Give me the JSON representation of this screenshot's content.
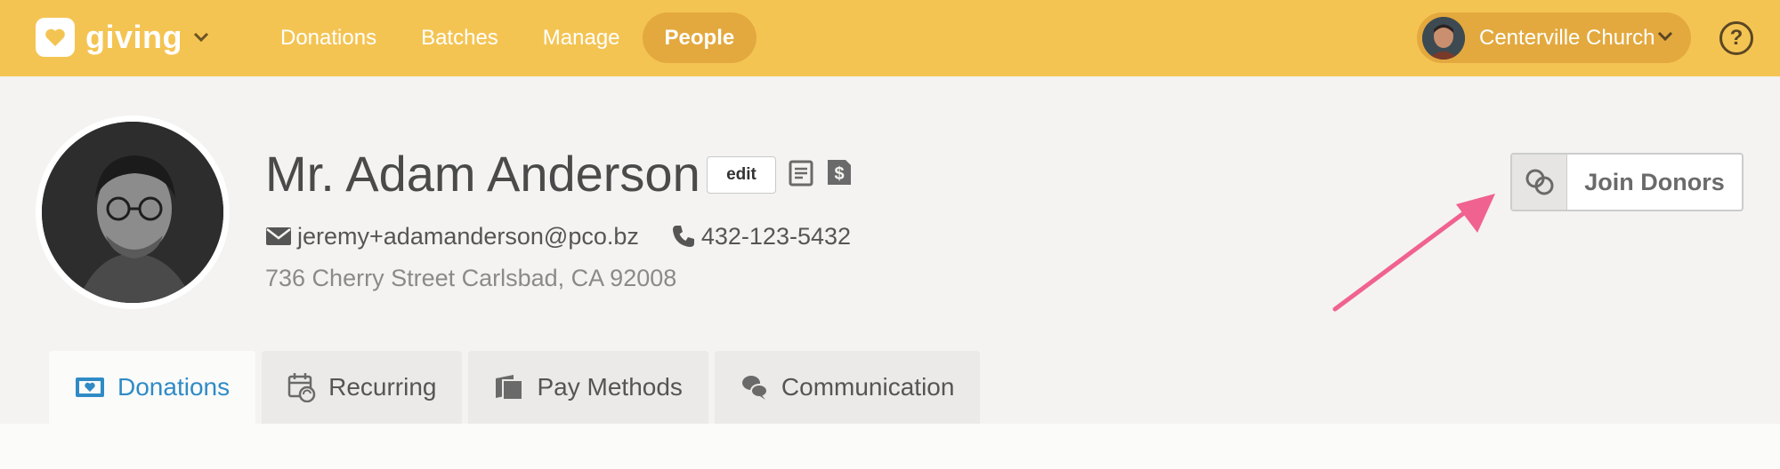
{
  "app": {
    "name": "giving",
    "colors": {
      "topbar": "#f4c453",
      "active_nav": "#e3a93e",
      "active_tab_text": "#2f8bc6",
      "annotation_arrow": "#f0628f"
    }
  },
  "nav": {
    "items": [
      {
        "label": "Donations",
        "active": false
      },
      {
        "label": "Batches",
        "active": false
      },
      {
        "label": "Manage",
        "active": false
      },
      {
        "label": "People",
        "active": true
      }
    ]
  },
  "org": {
    "name": "Centerville Church"
  },
  "help": {
    "label": "?"
  },
  "person": {
    "name": "Mr. Adam Anderson",
    "edit_label": "edit",
    "email": "jeremy+adamanderson@pco.bz",
    "phone": "432-123-5432",
    "address": "736 Cherry Street Carlsbad, CA 92008"
  },
  "actions": {
    "join_donors_label": "Join Donors"
  },
  "tabs": [
    {
      "label": "Donations",
      "icon": "heart-envelope-icon",
      "active": true
    },
    {
      "label": "Recurring",
      "icon": "calendar-recurring-icon",
      "active": false
    },
    {
      "label": "Pay Methods",
      "icon": "card-wallet-icon",
      "active": false
    },
    {
      "label": "Communication",
      "icon": "chat-bubbles-icon",
      "active": false
    }
  ]
}
